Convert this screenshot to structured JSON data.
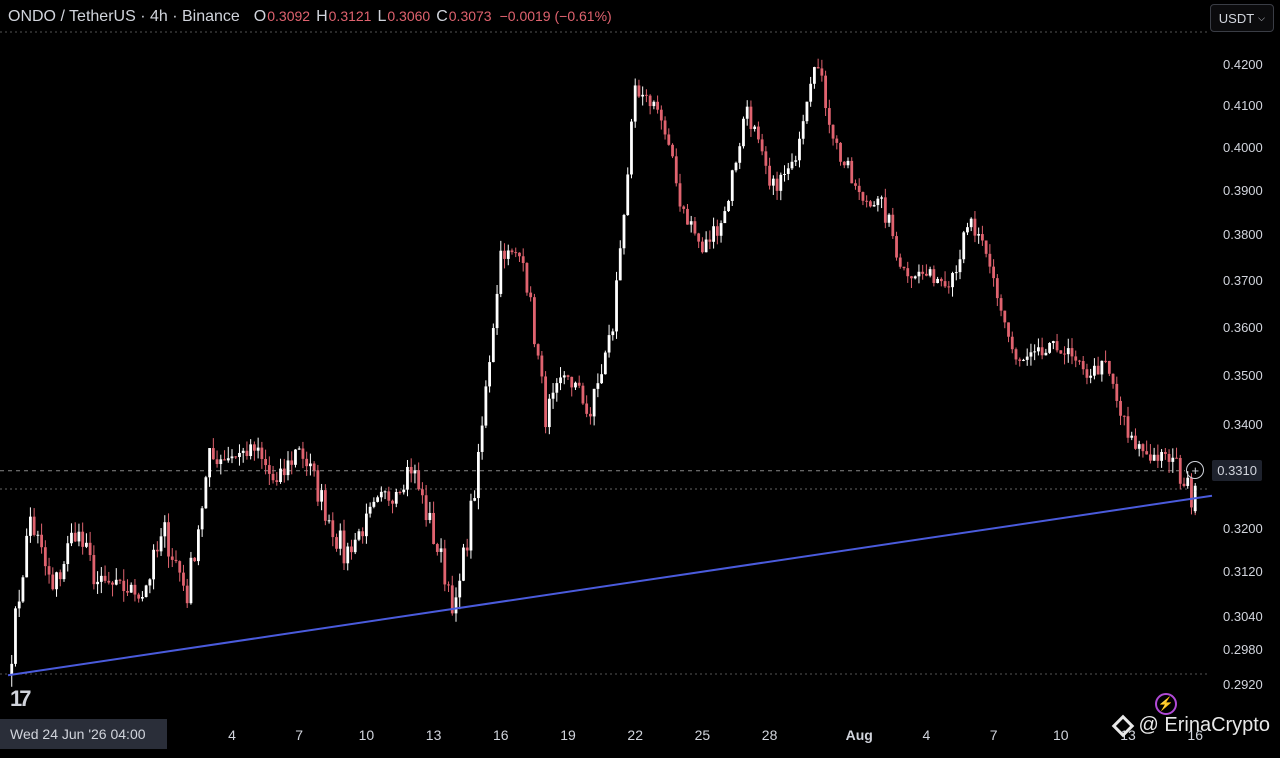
{
  "header": {
    "symbol": "ONDO / TetherUS · 4h · Binance",
    "open_label": "O",
    "open": "0.3092",
    "high_label": "H",
    "high": "0.3121",
    "low_label": "L",
    "low": "0.3060",
    "close_label": "C",
    "close": "0.3073",
    "change": "−0.0019 (−0.61%)"
  },
  "currency_button": {
    "label": "USDT",
    "icon": "chevron-down-icon"
  },
  "crosshair_time": "Wed 24 Jun '26   04:00",
  "current_price_tag": {
    "value": "0.3310",
    "icon": "plus-circle-icon"
  },
  "logo": {
    "text": "17",
    "icon": "tradingview-logo-icon"
  },
  "watermark": {
    "text": "@ ErinaCrypto",
    "icon": "diamond-logo-icon"
  },
  "colors": {
    "background": "#000000",
    "bullish": "#ffffff",
    "bearish": "#e0636f",
    "trendline": "#4a5bdc",
    "text": "#d1d4dc"
  },
  "chart_data": {
    "type": "candlestick",
    "price_axis": [
      "0.4200",
      "0.4100",
      "0.4000",
      "0.3900",
      "0.3800",
      "0.3700",
      "0.3600",
      "0.3500",
      "0.3400",
      "0.3200",
      "0.3120",
      "0.3040",
      "0.2980",
      "0.2920"
    ],
    "time_axis": [
      "4",
      "7",
      "10",
      "13",
      "16",
      "19",
      "22",
      "25",
      "28",
      "Aug",
      "4",
      "7",
      "10",
      "13",
      "16"
    ],
    "current_price": 0.331,
    "trendline": {
      "start": {
        "date": "Jun 24",
        "price": 0.2935
      },
      "end": {
        "date": "Aug 16",
        "price": 0.3255
      }
    },
    "anchors": [
      {
        "date": "Jun 24",
        "price": 0.2935
      },
      {
        "date": "Jun 25",
        "price": 0.322
      },
      {
        "date": "Jun 26",
        "price": 0.308
      },
      {
        "date": "Jun 27",
        "price": 0.32
      },
      {
        "date": "Jun 28",
        "price": 0.31
      },
      {
        "date": "Jun 30",
        "price": 0.308
      },
      {
        "date": "Jul 1",
        "price": 0.319
      },
      {
        "date": "Jul 2",
        "price": 0.308
      },
      {
        "date": "Jul 3",
        "price": 0.333
      },
      {
        "date": "Jul 5",
        "price": 0.335
      },
      {
        "date": "Jul 6",
        "price": 0.328
      },
      {
        "date": "Jul 7",
        "price": 0.336
      },
      {
        "date": "Jul 9",
        "price": 0.315
      },
      {
        "date": "Jul 10",
        "price": 0.321
      },
      {
        "date": "Jul 12",
        "price": 0.332
      },
      {
        "date": "Jul 14",
        "price": 0.305
      },
      {
        "date": "Jul 15",
        "price": 0.332
      },
      {
        "date": "Jul 16",
        "price": 0.376
      },
      {
        "date": "Jul 17",
        "price": 0.375
      },
      {
        "date": "Jul 18",
        "price": 0.342
      },
      {
        "date": "Jul 19",
        "price": 0.35
      },
      {
        "date": "Jul 20",
        "price": 0.342
      },
      {
        "date": "Jul 21",
        "price": 0.36
      },
      {
        "date": "Jul 22",
        "price": 0.412
      },
      {
        "date": "Jul 23",
        "price": 0.41
      },
      {
        "date": "Jul 24",
        "price": 0.388
      },
      {
        "date": "Jul 25",
        "price": 0.376
      },
      {
        "date": "Jul 26",
        "price": 0.385
      },
      {
        "date": "Jul 27",
        "price": 0.41
      },
      {
        "date": "Jul 28",
        "price": 0.39
      },
      {
        "date": "Jul 29",
        "price": 0.395
      },
      {
        "date": "Jul 30",
        "price": 0.422
      },
      {
        "date": "Jul 31",
        "price": 0.4
      },
      {
        "date": "Aug 1",
        "price": 0.388
      },
      {
        "date": "Aug 2",
        "price": 0.387
      },
      {
        "date": "Aug 3",
        "price": 0.372
      },
      {
        "date": "Aug 5",
        "price": 0.37
      },
      {
        "date": "Aug 6",
        "price": 0.382
      },
      {
        "date": "Aug 7",
        "price": 0.37
      },
      {
        "date": "Aug 8",
        "price": 0.352
      },
      {
        "date": "Aug 10",
        "price": 0.356
      },
      {
        "date": "Aug 11",
        "price": 0.35
      },
      {
        "date": "Aug 12",
        "price": 0.352
      },
      {
        "date": "Aug 13",
        "price": 0.337
      },
      {
        "date": "Aug 14",
        "price": 0.334
      },
      {
        "date": "Aug 15",
        "price": 0.333
      },
      {
        "date": "Aug 16",
        "price": 0.325
      },
      {
        "date": "Aug 16",
        "price": 0.33
      }
    ]
  }
}
